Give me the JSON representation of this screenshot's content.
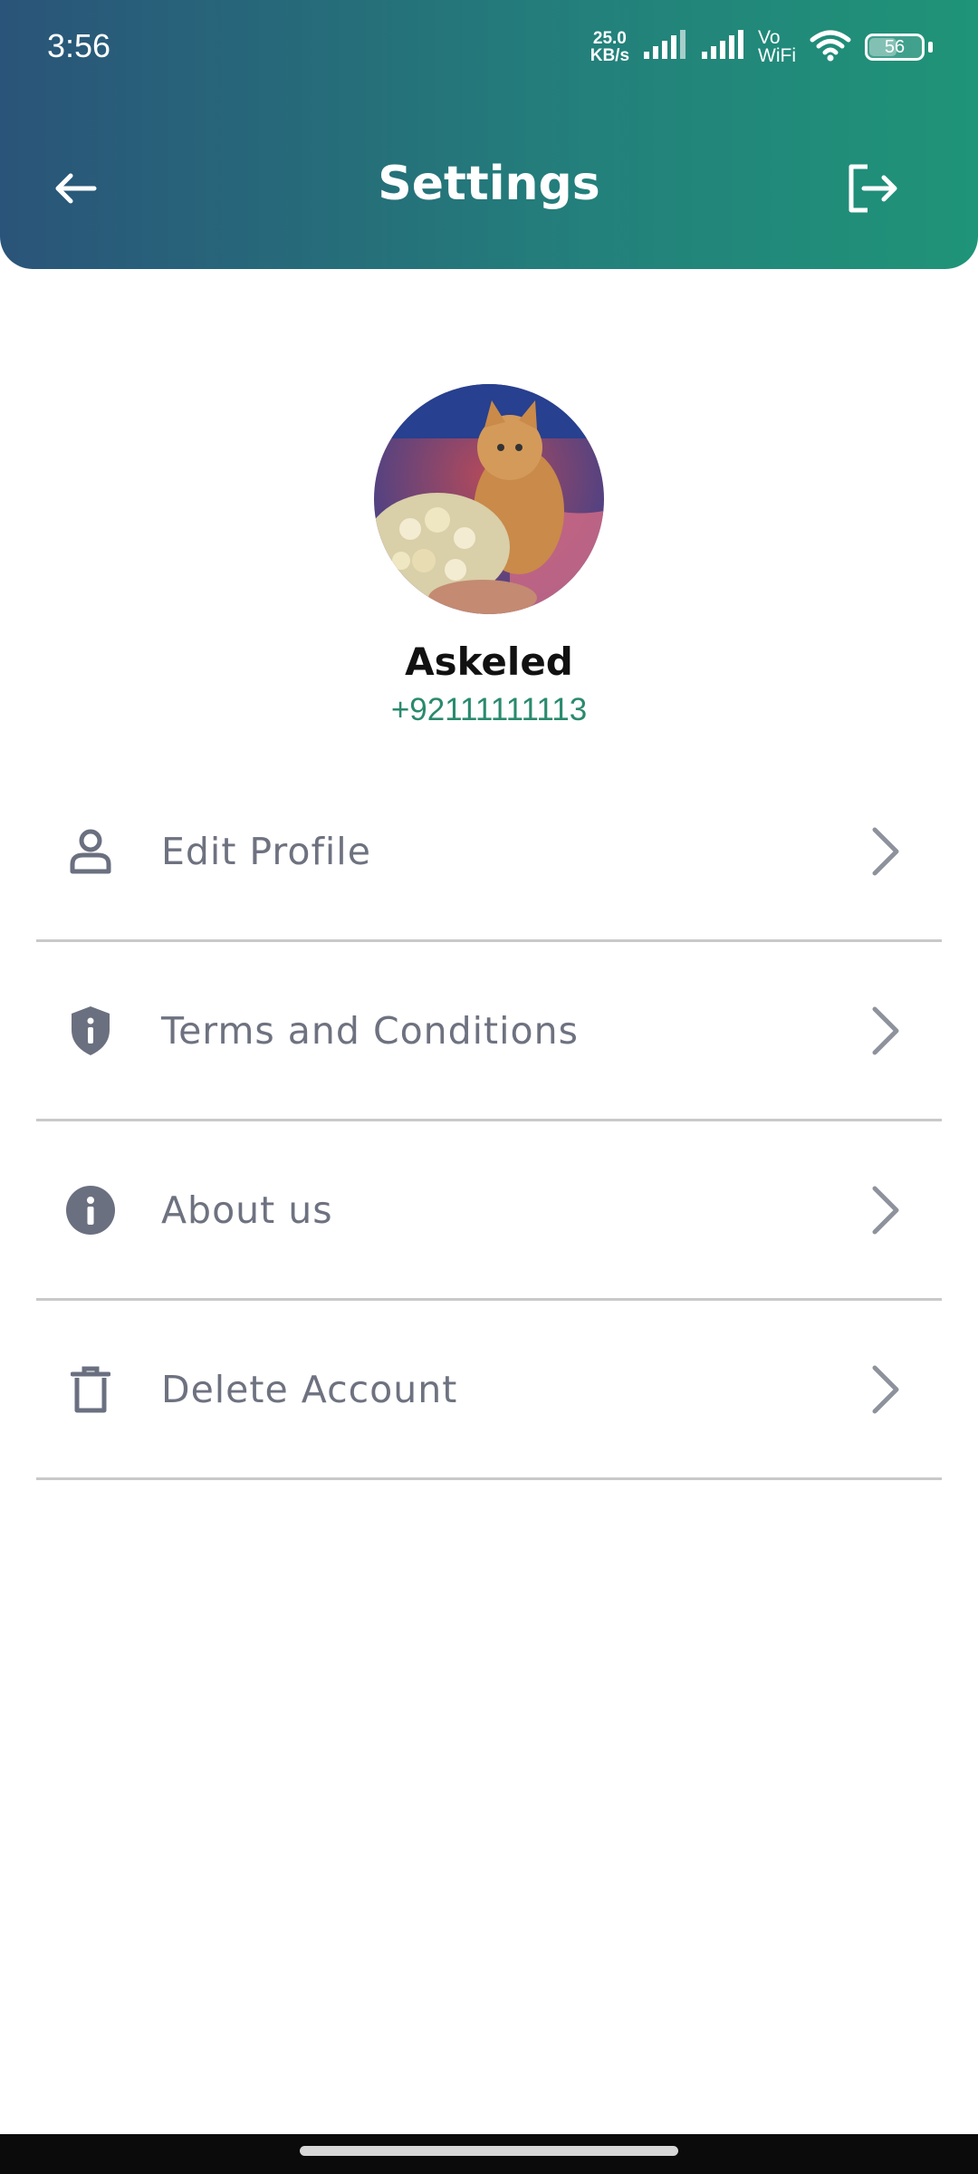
{
  "status_bar": {
    "time": "3:56",
    "net_speed_value": "25.0",
    "net_speed_unit": "KB/s",
    "vowifi_top": "Vo",
    "vowifi_bottom": "WiFi",
    "battery_level": "56",
    "battery_fraction": 0.56
  },
  "header": {
    "title": "Settings",
    "back_icon": "arrow-left-icon",
    "logout_icon": "logout-icon",
    "gradient_colors": [
      "#2a5479",
      "#23807b",
      "#1f9478"
    ]
  },
  "profile": {
    "name": "Askeled",
    "phone": "+92111111113",
    "avatar_description_icon": "avatar-photo"
  },
  "menu": {
    "items": [
      {
        "label": "Edit Profile",
        "icon": "user-icon"
      },
      {
        "label": "Terms and Conditions",
        "icon": "shield-info-icon"
      },
      {
        "label": "About us",
        "icon": "info-circle-icon"
      },
      {
        "label": "Delete Account",
        "icon": "trash-icon"
      }
    ]
  },
  "colors": {
    "accent_green": "#2a8a6e",
    "menu_text": "#6e7280",
    "icon_gray": "#6b7080",
    "divider": "#c9c9c9"
  }
}
